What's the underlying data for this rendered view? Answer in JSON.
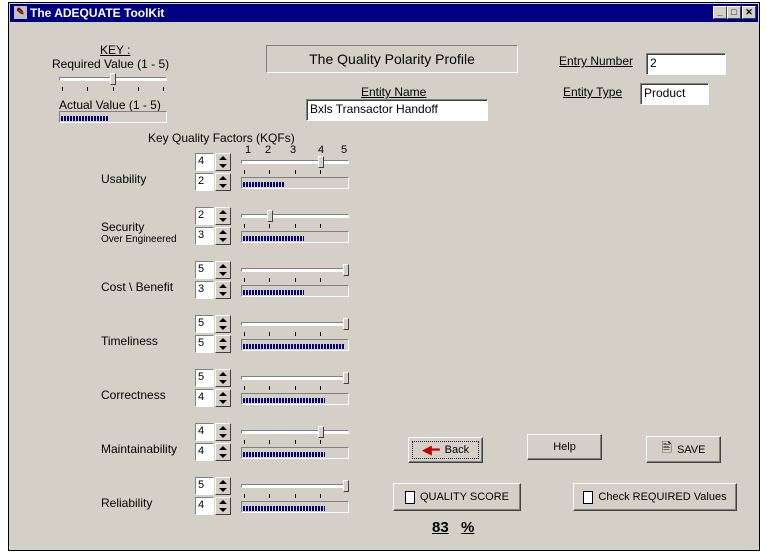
{
  "window": {
    "title": "The ADEQUATE ToolKit",
    "controls": [
      "_",
      "□",
      "✕"
    ]
  },
  "key": {
    "heading": "KEY :",
    "required_label": "Required Value (1 - 5)",
    "required_value": 3,
    "actual_label": "Actual Value (1 - 5)",
    "actual_value": 2
  },
  "profile_title": "The Quality Polarity Profile",
  "entity": {
    "name_label": "Entity Name",
    "name_value": "Bxls Transactor Handoff",
    "number_label": "Entry Number",
    "number_value": "2",
    "type_label": "Entity Type",
    "type_value": "Product"
  },
  "kqf": {
    "heading": "Key Quality Factors (KQFs)",
    "scale": [
      "1",
      "2",
      "3",
      "4",
      "5"
    ],
    "factors": [
      {
        "name": "Usability",
        "sub": "",
        "required": "4",
        "actual": "2"
      },
      {
        "name": "Security",
        "sub": "Over Engineered",
        "required": "2",
        "actual": "3"
      },
      {
        "name": "Cost \\ Benefit",
        "sub": "",
        "required": "5",
        "actual": "3"
      },
      {
        "name": "Timeliness",
        "sub": "",
        "required": "5",
        "actual": "5"
      },
      {
        "name": "Correctness",
        "sub": "",
        "required": "5",
        "actual": "4"
      },
      {
        "name": "Maintainability",
        "sub": "",
        "required": "4",
        "actual": "4"
      },
      {
        "name": "Reliability",
        "sub": "",
        "required": "5",
        "actual": "4"
      }
    ]
  },
  "buttons": {
    "back": "Back",
    "help": "Help",
    "save": "SAVE",
    "quality_score": "QUALITY SCORE",
    "check_required": "Check REQUIRED Values"
  },
  "score": {
    "value": "83",
    "unit": "%"
  },
  "icons": [
    "app-icon",
    "back-arrow-icon",
    "save-icon",
    "calculator-icon"
  ]
}
